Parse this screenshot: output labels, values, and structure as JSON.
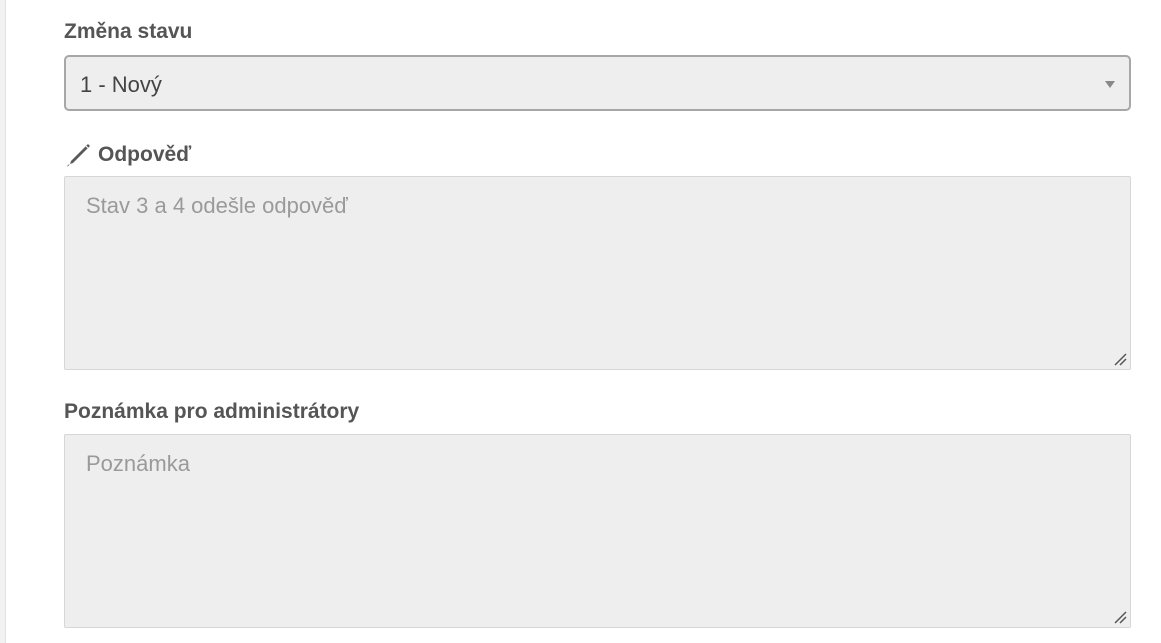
{
  "status_field": {
    "label": "Změna stavu",
    "selected_value": "1 - Nový"
  },
  "reply_field": {
    "icon": "pen-icon",
    "label": "Odpověď",
    "placeholder": "Stav 3 a 4 odešle odpověď"
  },
  "note_field": {
    "label": "Poznámka pro administrátory",
    "placeholder": "Poznámka"
  }
}
